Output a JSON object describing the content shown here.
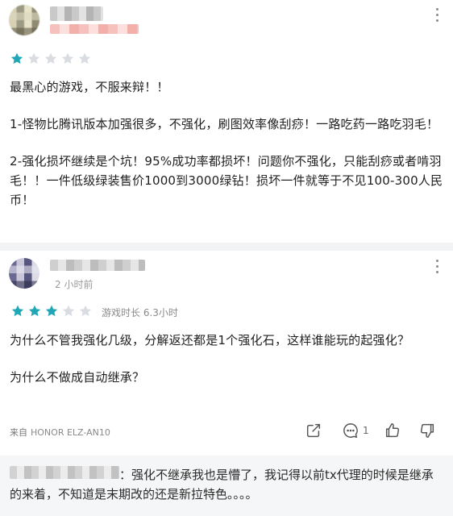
{
  "review1": {
    "rating": 1,
    "max_rating": 5,
    "paragraphs": [
      "最黑心的游戏，不服来辩！！",
      "1-怪物比腾讯版本加强很多，不强化，刷图效率像刮痧！一路吃药一路吃羽毛！",
      "2-强化损坏继续是个坑！95%成功率都损坏！问题你不强化，只能刮痧或者啃羽毛！！一件低级绿装售价1000到3000绿钻！损坏一件就等于不见100-300人民币！"
    ]
  },
  "review2": {
    "time": "2 小时前",
    "rating": 3,
    "max_rating": 5,
    "playtime": "游戏时长 6.3小时",
    "paragraphs": [
      "为什么不管我强化几级，分解返还都是1个强化石，这样谁能玩的起强化？",
      "为什么不做成自动继承？"
    ],
    "device_prefix": "来自",
    "device": "HONOR ELZ-AN10",
    "comment_count": "1"
  },
  "reply": {
    "separator": "：",
    "text": "强化不继承我也是懵了，我记得以前tx代理的时候是继承的来着，不知道是末期改的还是新拉特色。。。。"
  },
  "colors": {
    "star_filled": "#1fa7b5",
    "star_empty": "#d9dde2",
    "background": "#ffffff",
    "divider": "#f2f3f5"
  },
  "icons": [
    "more-vertical-icon",
    "star-icon",
    "share-icon",
    "comment-icon",
    "thumbs-up-icon",
    "thumbs-down-icon"
  ]
}
